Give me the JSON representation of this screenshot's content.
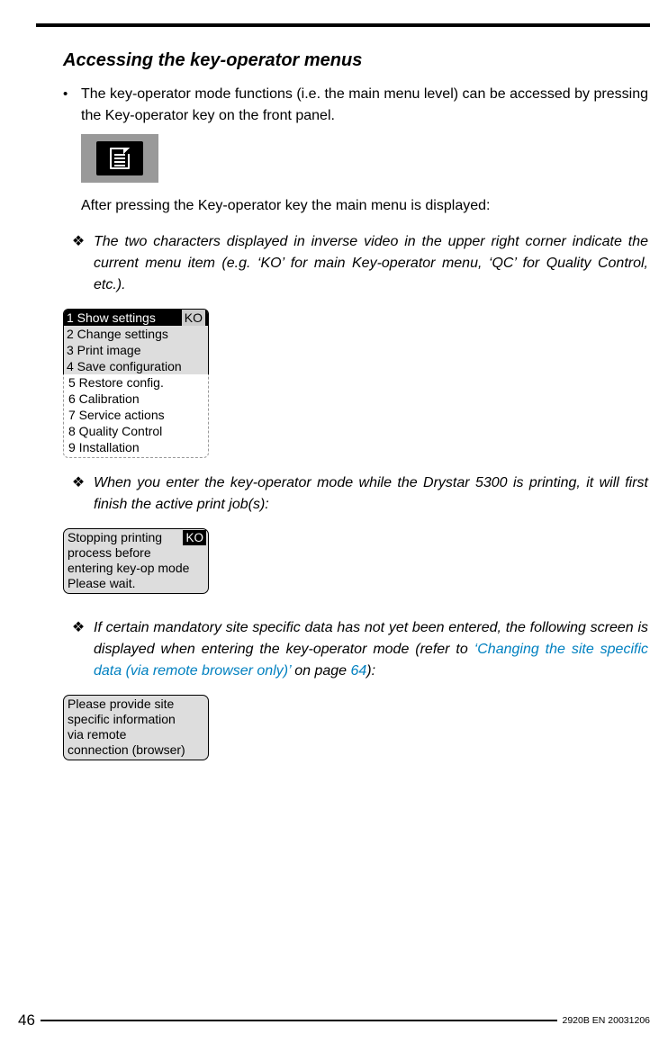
{
  "heading": "Accessing the key-operator menus",
  "bullet1": "The key-operator mode functions (i.e. the main menu level) can be accessed by pressing the Key-operator key on the front panel.",
  "after_press": "After pressing the Key-operator key the main menu is displayed:",
  "note1": "The two characters displayed in inverse video in the upper right corner indicate the current menu item (e.g. ‘KO’ for main Key-operator menu, ‘QC’ for Quality Control, etc.).",
  "menu": {
    "selected": "1 Show settings",
    "ko": "KO",
    "r2": "2 Change settings",
    "r3": "3 Print image",
    "r4": "4 Save configuration",
    "r5": "5 Restore config.",
    "r6": "6 Calibration",
    "r7": "7 Service actions",
    "r8": "8 Quality Control",
    "r9": "9 Installation"
  },
  "note2": "When you enter the key-operator mode while the Drystar 5300 is printing, it will first finish the active print job(s):",
  "lcd2": {
    "l1": "Stopping printing",
    "ko": "KO",
    "l2": "process before",
    "l3": "entering key-op mode",
    "l4": "Please wait."
  },
  "note3_pre": "If certain mandatory site specific data has not yet been entered, the following screen is displayed when entering the key-operator mode (refer to ",
  "note3_link": "‘Changing the site specific data (via remote browser only)’",
  "note3_mid": " on page ",
  "note3_page": "64",
  "note3_post": "):",
  "lcd3": {
    "l1": "Please provide site",
    "l2": "specific information",
    "l3": "via remote",
    "l4": "connection (browser)"
  },
  "footer": {
    "page": "46",
    "code": "2920B EN 20031206"
  }
}
